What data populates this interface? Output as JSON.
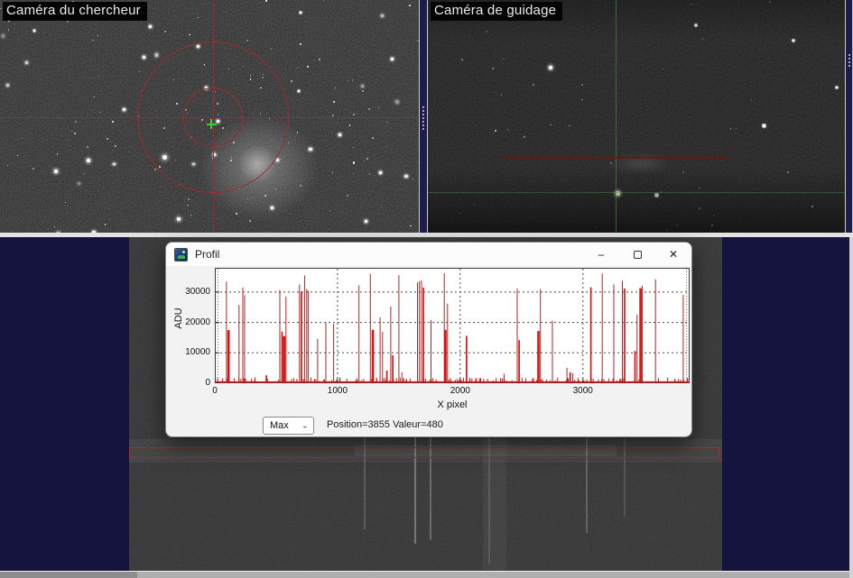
{
  "panels": {
    "finder": {
      "label": "Caméra du chercheur"
    },
    "guide": {
      "label": "Caméra de guidage"
    }
  },
  "profil": {
    "title": "Profil",
    "window_controls": {
      "minimize": "–",
      "maximize": "",
      "close": "✕"
    },
    "selector": {
      "value": "Max"
    },
    "status": "Position=3855 Valeur=480"
  },
  "colors": {
    "crosshair_red": "#9c2c2c",
    "guide_green": "#46a046",
    "guide_red_line": "#6e1414",
    "spike_red": "#d81414",
    "spike_dark_red": "#a82828",
    "selection_box_red": "#bf2222",
    "desktop_navy": "#14143e"
  },
  "chart_data": {
    "type": "bar",
    "title": "",
    "xlabel": "X pixel",
    "ylabel": "ADU",
    "xlim": [
      0,
      3870
    ],
    "ylim": [
      0,
      38000
    ],
    "xticks": [
      0,
      1000,
      2000,
      3000
    ],
    "yticks": [
      0,
      10000,
      20000,
      30000
    ],
    "grid": "dashed",
    "legend": "none",
    "baseline_adu": 480,
    "cursor_readout": {
      "position": 3855,
      "value": 480
    },
    "spikes_x_adu_w": [
      [
        95,
        33500,
        1
      ],
      [
        112,
        17500,
        3
      ],
      [
        197,
        25800,
        1
      ],
      [
        228,
        31500,
        1
      ],
      [
        243,
        29000,
        1
      ],
      [
        420,
        2600,
        2
      ],
      [
        530,
        30700,
        1
      ],
      [
        548,
        17000,
        2
      ],
      [
        565,
        15500,
        3
      ],
      [
        580,
        28500,
        1
      ],
      [
        690,
        32500,
        1
      ],
      [
        706,
        30200,
        2
      ],
      [
        733,
        35500,
        1
      ],
      [
        749,
        31000,
        1
      ],
      [
        762,
        30500,
        1
      ],
      [
        838,
        14600,
        1
      ],
      [
        905,
        20000,
        1
      ],
      [
        968,
        19600,
        1
      ],
      [
        1175,
        32200,
        1
      ],
      [
        1268,
        36000,
        1
      ],
      [
        1288,
        17600,
        3
      ],
      [
        1347,
        21700,
        1
      ],
      [
        1367,
        17000,
        1
      ],
      [
        1402,
        4200,
        2
      ],
      [
        1434,
        25300,
        1
      ],
      [
        1450,
        9200,
        2
      ],
      [
        1500,
        35600,
        1
      ],
      [
        1525,
        3600,
        1
      ],
      [
        1652,
        33200,
        1
      ],
      [
        1668,
        33600,
        1
      ],
      [
        1684,
        33900,
        1
      ],
      [
        1700,
        31500,
        2
      ],
      [
        1762,
        20800,
        1
      ],
      [
        1870,
        36200,
        1
      ],
      [
        1880,
        17600,
        3
      ],
      [
        1897,
        26200,
        1
      ],
      [
        2052,
        15600,
        2
      ],
      [
        2078,
        1800,
        1
      ],
      [
        2270,
        900,
        1
      ],
      [
        2358,
        3100,
        1
      ],
      [
        2465,
        31200,
        1
      ],
      [
        2480,
        14200,
        2
      ],
      [
        2638,
        17200,
        3
      ],
      [
        2654,
        31000,
        1
      ],
      [
        2752,
        20600,
        1
      ],
      [
        2870,
        5100,
        1
      ],
      [
        2897,
        3600,
        2
      ],
      [
        2918,
        3300,
        1
      ],
      [
        3065,
        31600,
        2
      ],
      [
        3158,
        36100,
        1
      ],
      [
        3252,
        32600,
        1
      ],
      [
        3322,
        33700,
        1
      ],
      [
        3340,
        31200,
        2
      ],
      [
        3425,
        10600,
        2
      ],
      [
        3442,
        22600,
        1
      ],
      [
        3470,
        31300,
        3
      ],
      [
        3484,
        32100,
        1
      ],
      [
        3592,
        34200,
        1
      ],
      [
        3818,
        29100,
        1
      ]
    ]
  }
}
